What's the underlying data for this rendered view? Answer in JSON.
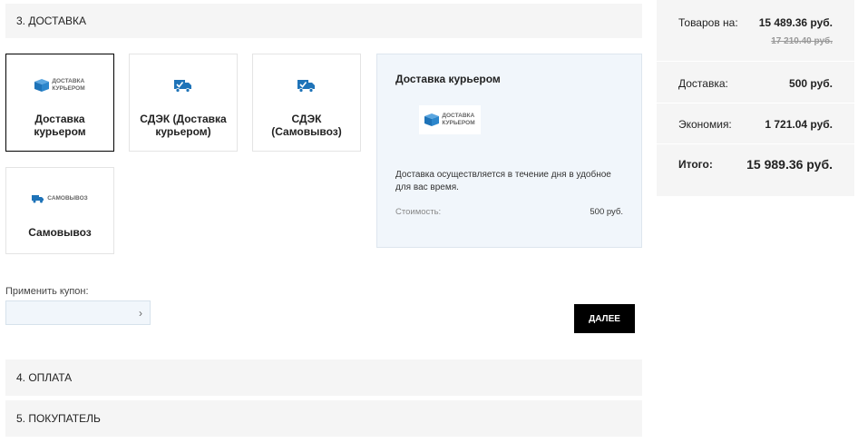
{
  "sections": {
    "delivery_title": "3. ДОСТАВКА",
    "payment_title": "4. ОПЛАТА",
    "buyer_title": "5. ПОКУПАТЕЛЬ"
  },
  "delivery_options": [
    {
      "label": "Доставка курьером",
      "logo_text_1": "ДОСТАВКА",
      "logo_text_2": "КУРЬЕРОМ",
      "icon": "box-icon",
      "selected": true
    },
    {
      "label": "СДЭК (Доставка курьером)",
      "icon": "delivery-truck-check-icon",
      "selected": false
    },
    {
      "label": "СДЭК (Самовывоз)",
      "icon": "delivery-truck-check-icon",
      "selected": false
    },
    {
      "label": "Самовывоз",
      "logo_text_1": "САМОВЫВОЗ",
      "icon": "truck-icon",
      "selected": false
    }
  ],
  "detail": {
    "title": "Доставка курьером",
    "logo_text_1": "ДОСТАВКА",
    "logo_text_2": "КУРЬЕРОМ",
    "description": "Доставка осуществляется в течение дня в удобное для вас время.",
    "cost_label": "Стоимость:",
    "cost_value": "500 руб."
  },
  "coupon": {
    "label": "Применить купон:",
    "value": "",
    "placeholder": "",
    "arrow": "›"
  },
  "next_button_label": "ДАЛЕЕ",
  "summary": {
    "goods_label": "Товаров на:",
    "goods_value": "15 489.36 руб.",
    "goods_old_value": "17 210.40 руб.",
    "delivery_label": "Доставка:",
    "delivery_value": "500 руб.",
    "economy_label": "Экономия:",
    "economy_value": "1 721.04 руб.",
    "total_label": "Итого:",
    "total_value": "15 989.36 руб."
  },
  "colors": {
    "accent_blue": "#1e73b8",
    "selected_border": "#000000",
    "panel_bg": "#f1f6fb",
    "header_bg": "#f5f5f5"
  }
}
